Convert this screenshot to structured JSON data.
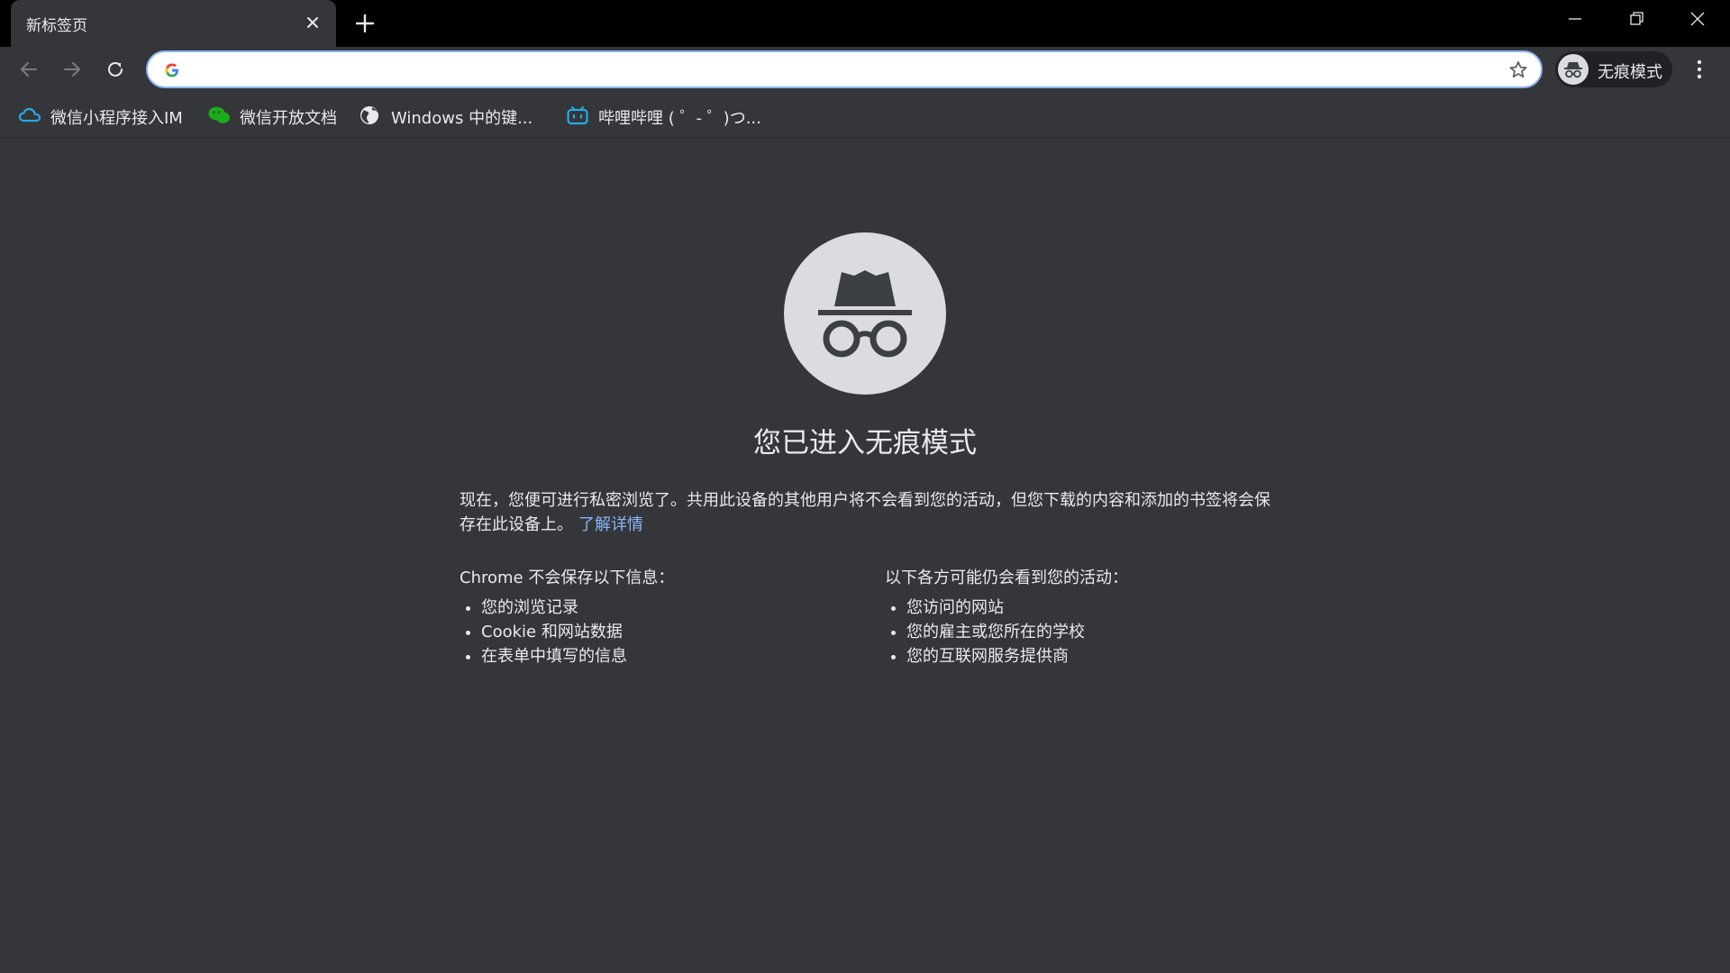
{
  "tab": {
    "title": "新标签页"
  },
  "omnibox": {
    "value": "",
    "placeholder": ""
  },
  "profile": {
    "label": "无痕模式"
  },
  "bookmarks": [
    {
      "label": "微信小程序接入IM",
      "icon": "cloud-icon"
    },
    {
      "label": "微信开放文档",
      "icon": "wechat-icon"
    },
    {
      "label": "Windows 中的键...",
      "icon": "globe-icon"
    },
    {
      "label": "哔哩哔哩 ( ゜- ゜)つ...",
      "icon": "bilibili-icon"
    }
  ],
  "page": {
    "heading": "您已进入无痕模式",
    "intro": "现在，您便可进行私密浏览了。共用此设备的其他用户将不会看到您的活动，但您下载的内容和添加的书签将会保存在此设备上。",
    "learn_more": "了解详情",
    "left_column": {
      "title": "Chrome 不会保存以下信息：",
      "items": [
        "您的浏览记录",
        "Cookie 和网站数据",
        "在表单中填写的信息"
      ]
    },
    "right_column": {
      "title": "以下各方可能仍会看到您的活动：",
      "items": [
        "您访问的网站",
        "您的雇主或您所在的学校",
        "您的互联网服务提供商"
      ]
    }
  },
  "colors": {
    "frame": "#000000",
    "surface": "#35363a",
    "text": "#e8eaed",
    "link": "#8ab4f8",
    "accent_blue": "#8ab4f8"
  }
}
